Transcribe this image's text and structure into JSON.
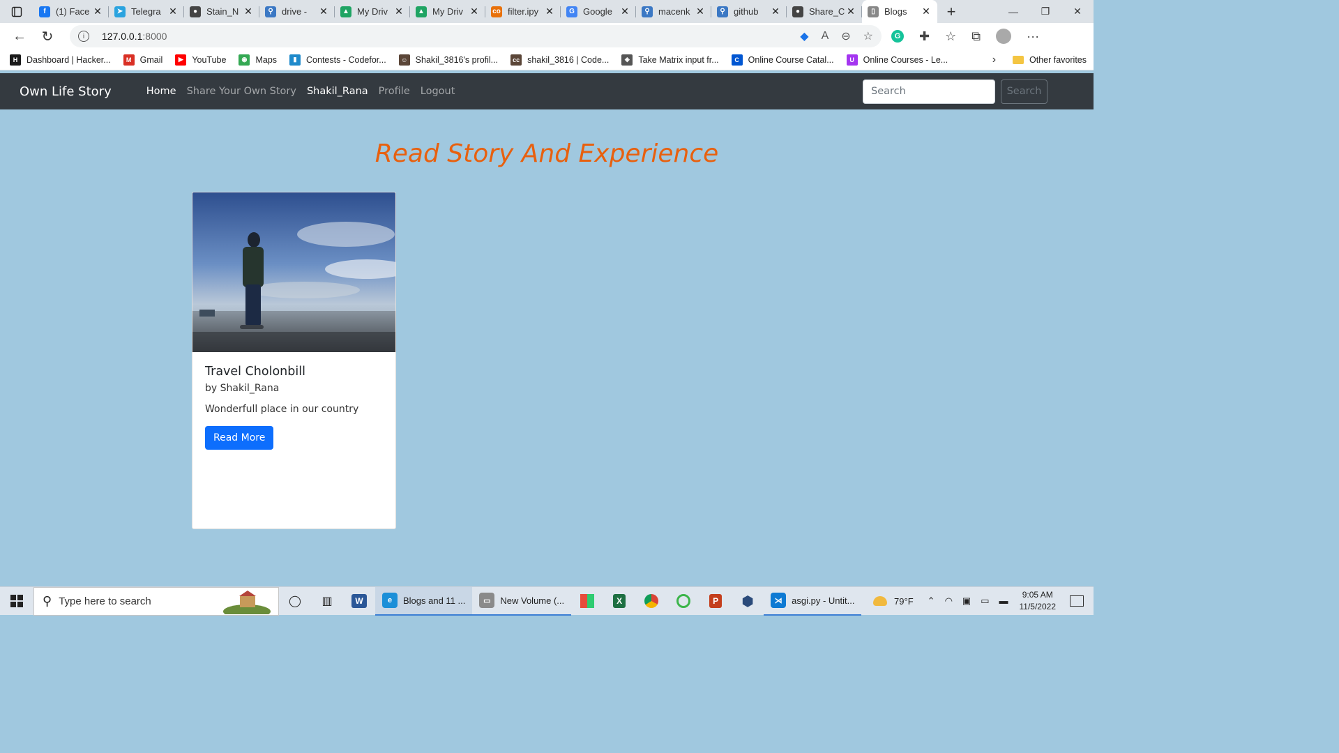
{
  "browser": {
    "tabs": [
      {
        "label": "(1) Face",
        "icon": "facebook-icon",
        "color": "#1877f2",
        "glyph": "f"
      },
      {
        "label": "Telegra",
        "icon": "telegram-icon",
        "color": "#2aa3df",
        "glyph": "➤"
      },
      {
        "label": "Stain_N",
        "icon": "github-icon",
        "color": "#444444",
        "glyph": "●"
      },
      {
        "label": "drive - ",
        "icon": "search-icon",
        "color": "#3b78c4",
        "glyph": "⚲"
      },
      {
        "label": "My Driv",
        "icon": "google-drive-icon",
        "color": "#1fa463",
        "glyph": "▲"
      },
      {
        "label": "My Driv",
        "icon": "google-drive-icon",
        "color": "#1fa463",
        "glyph": "▲"
      },
      {
        "label": "filter.ipy",
        "icon": "colab-icon",
        "color": "#e8710a",
        "glyph": "co"
      },
      {
        "label": "Google",
        "icon": "google-translate-icon",
        "color": "#4285f4",
        "glyph": "G"
      },
      {
        "label": "macenk",
        "icon": "search-icon",
        "color": "#3b78c4",
        "glyph": "⚲"
      },
      {
        "label": "github",
        "icon": "search-icon",
        "color": "#3b78c4",
        "glyph": "⚲"
      },
      {
        "label": "Share_C",
        "icon": "github-icon",
        "color": "#444444",
        "glyph": "●"
      },
      {
        "label": "Blogs",
        "icon": "page-icon",
        "color": "#888888",
        "glyph": "▯"
      }
    ],
    "active_tab": 11,
    "url_host": "127.0.0.1",
    "url_port": ":8000",
    "bookmarks": [
      {
        "label": "Dashboard | Hacker...",
        "icon": "hackerrank-icon",
        "color": "#1a1a1a",
        "glyph": "H"
      },
      {
        "label": "Gmail",
        "icon": "gmail-icon",
        "color": "#d93025",
        "glyph": "M"
      },
      {
        "label": "YouTube",
        "icon": "youtube-icon",
        "color": "#ff0000",
        "glyph": "▶"
      },
      {
        "label": "Maps",
        "icon": "maps-icon",
        "color": "#34a853",
        "glyph": "◉"
      },
      {
        "label": "Contests - Codefor...",
        "icon": "codeforces-icon",
        "color": "#1f8acb",
        "glyph": "▮"
      },
      {
        "label": "Shakil_3816's profil...",
        "icon": "codechef-icon",
        "color": "#5b4638",
        "glyph": "☺"
      },
      {
        "label": "shakil_3816 | Code...",
        "icon": "codechef-icon",
        "color": "#5b4638",
        "glyph": "cc"
      },
      {
        "label": "Take Matrix input fr...",
        "icon": "geeks-icon",
        "color": "#555555",
        "glyph": "◈"
      },
      {
        "label": "Online Course Catal...",
        "icon": "coursera-icon",
        "color": "#0056d2",
        "glyph": "C"
      },
      {
        "label": "Online Courses - Le...",
        "icon": "udemy-icon",
        "color": "#a435f0",
        "glyph": "U"
      }
    ],
    "other_favorites": "Other favorites"
  },
  "site": {
    "brand": "Own Life Story",
    "nav": [
      "Home",
      "Share Your Own Story",
      "Shakil_Rana",
      "Profile",
      "Logout"
    ],
    "search_placeholder": "Search",
    "search_button": "Search",
    "headline": "Read Story And Experience",
    "card": {
      "title": "Travel Cholonbill",
      "author": "by Shakil_Rana",
      "text": "Wonderfull place in our country",
      "button": "Read More"
    }
  },
  "taskbar": {
    "search_placeholder": "Type here to search",
    "apps": [
      {
        "label": "Blogs and 11 ...",
        "icon": "edge-icon",
        "color": "#1b8fd8",
        "glyph": "e",
        "active": true
      },
      {
        "label": "New Volume (...",
        "icon": "file-explorer-icon",
        "color": "#8a8a8a",
        "glyph": "▭",
        "active": false
      },
      {
        "label": "asgi.py - Untit...",
        "icon": "vscode-icon",
        "color": "#0e7ad3",
        "glyph": "⋊",
        "active": false
      }
    ],
    "weather": "79°F",
    "time": "9:05 AM",
    "date": "11/5/2022"
  }
}
